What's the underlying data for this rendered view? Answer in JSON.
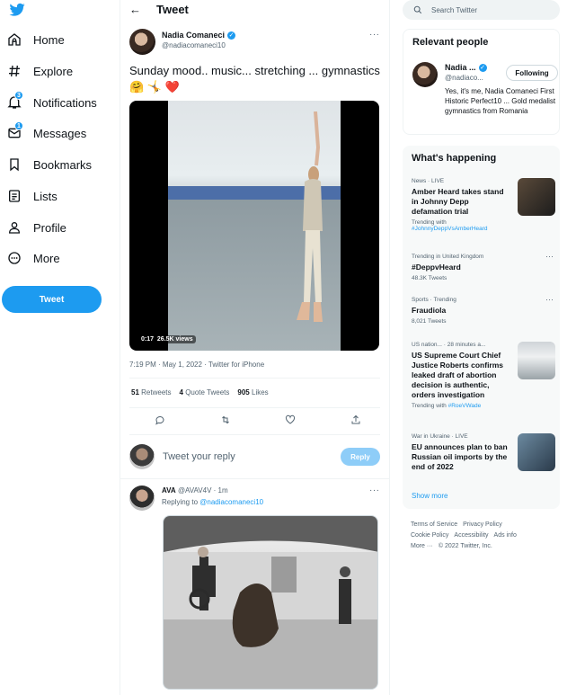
{
  "nav": {
    "items": [
      {
        "label": "Home",
        "icon": "home-icon"
      },
      {
        "label": "Explore",
        "icon": "hashtag-icon"
      },
      {
        "label": "Notifications",
        "icon": "bell-icon",
        "badge": "3"
      },
      {
        "label": "Messages",
        "icon": "envelope-icon",
        "badge": "1"
      },
      {
        "label": "Bookmarks",
        "icon": "bookmark-icon"
      },
      {
        "label": "Lists",
        "icon": "list-icon"
      },
      {
        "label": "Profile",
        "icon": "person-icon"
      },
      {
        "label": "More",
        "icon": "more-circle-icon"
      }
    ],
    "tweet_button": "Tweet"
  },
  "main": {
    "header_title": "Tweet",
    "author": {
      "name": "Nadia Comaneci",
      "handle": "@nadiacomaneci10"
    },
    "text": "Sunday mood.. music... stretching ... gymnastics 🤗 🤸 ❤️",
    "video": {
      "duration": "0:17",
      "views": "26.5K views"
    },
    "timestamp": "7:19 PM · May 1, 2022 · Twitter for iPhone",
    "stats": {
      "retweets_count": "51",
      "retweets_label": "Retweets",
      "quotes_count": "4",
      "quotes_label": "Quote Tweets",
      "likes_count": "905",
      "likes_label": "Likes"
    },
    "reply_placeholder": "Tweet your reply",
    "reply_button": "Reply",
    "reply": {
      "name": "AVA",
      "handle_time": "@AVAV4V · 1m",
      "replying_prefix": "Replying to",
      "replying_to": "@nadiacomaneci10"
    }
  },
  "right": {
    "search_placeholder": "Search Twitter",
    "relevant": {
      "title": "Relevant people",
      "name": "Nadia ...",
      "handle": "@nadiaco...",
      "follow_label": "Following",
      "bio": "Yes, it's me, Nadia Comaneci First Historic Perfect10 ... Gold medalist gymnastics from Romania"
    },
    "happening": {
      "title": "What's happening",
      "trends": [
        {
          "meta": "News · LIVE",
          "title": "Amber Heard takes stand in Johnny Depp defamation trial",
          "sub_prefix": "Trending with",
          "sub_tag": "#JohnnyDeppVsAmberHeard"
        },
        {
          "meta": "Trending in United Kingdom",
          "title": "#DeppvHeard",
          "sub": "48.3K Tweets"
        },
        {
          "meta": "Sports · Trending",
          "title": "Fraudiola",
          "sub": "8,021 Tweets"
        },
        {
          "meta": "US nation... · 28 minutes a...",
          "title": "US Supreme Court Chief Justice Roberts confirms leaked draft of abortion decision is authentic, orders investigation",
          "sub_prefix": "Trending with",
          "sub_tag": "#RoeVWade"
        },
        {
          "meta": "War in Ukraine · LIVE",
          "title": "EU announces plan to ban Russian oil imports by the end of 2022"
        }
      ],
      "show_more": "Show more"
    },
    "footer": {
      "links": [
        "Terms of Service",
        "Privacy Policy",
        "Cookie Policy",
        "Accessibility",
        "Ads info",
        "More ···"
      ],
      "copyright": "© 2022 Twitter, Inc."
    }
  },
  "colors": {
    "accent": "#1d9bf0",
    "heart": "#e0245e",
    "muted": "#536471",
    "text": "#0f1419"
  }
}
